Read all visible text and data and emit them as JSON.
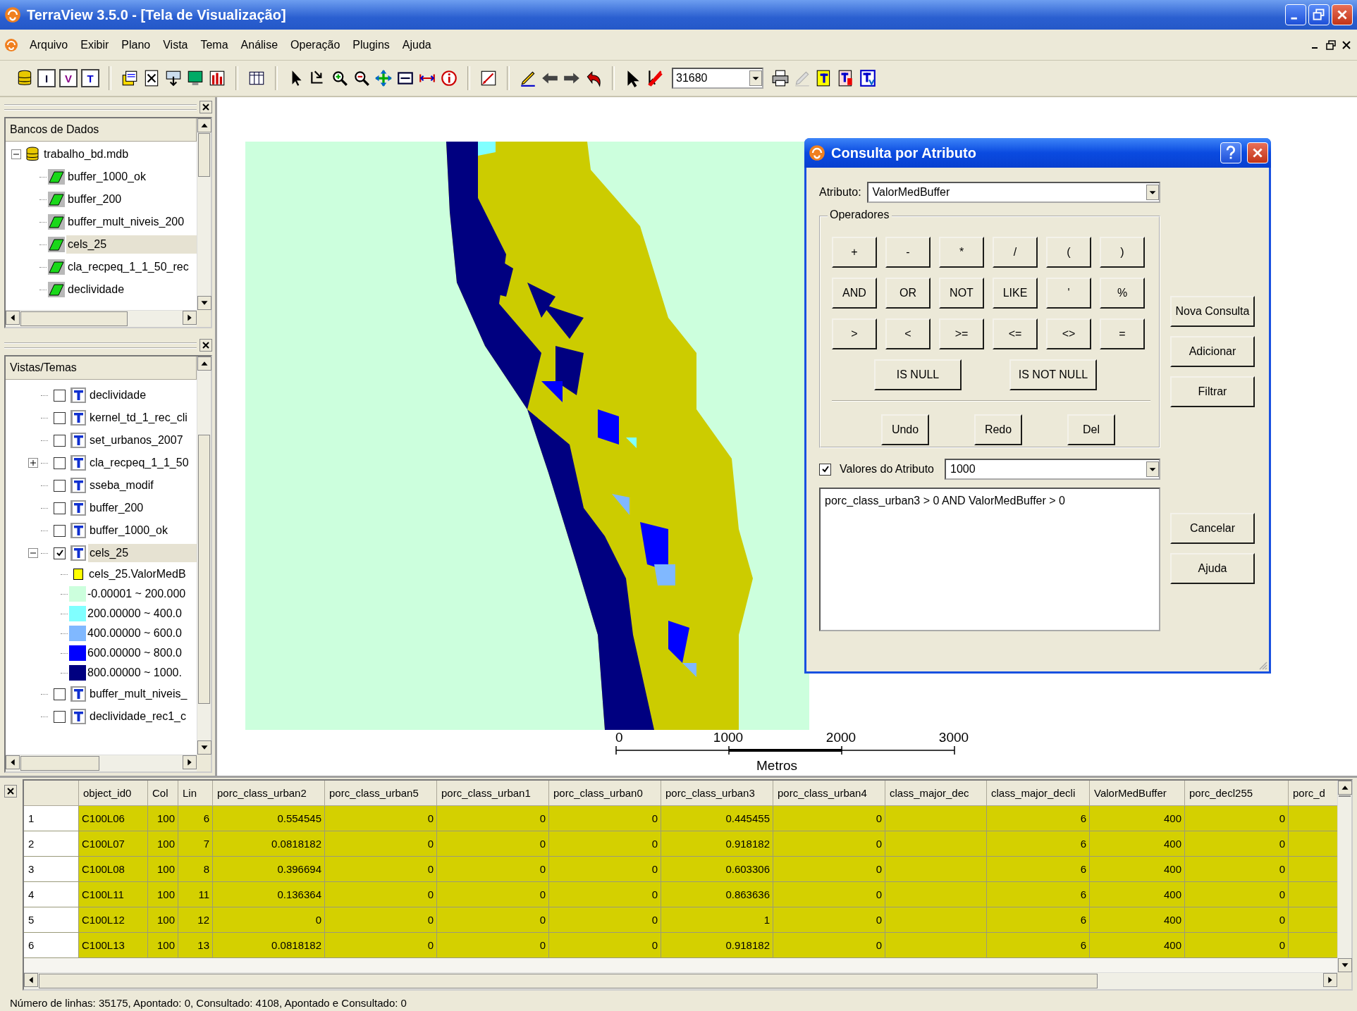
{
  "window": {
    "title": "TerraView 3.5.0 - [Tela de Visualização]"
  },
  "menu": [
    "Arquivo",
    "Exibir",
    "Plano",
    "Vista",
    "Tema",
    "Análise",
    "Operação",
    "Plugins",
    "Ajuda"
  ],
  "toolbar": [
    {
      "kind": "database"
    },
    {
      "kind": "letter",
      "text": "I"
    },
    {
      "kind": "letter",
      "text": "V"
    },
    {
      "kind": "letter",
      "text": "T"
    },
    {
      "kind": "sep"
    },
    {
      "kind": "layers"
    },
    {
      "kind": "document"
    },
    {
      "kind": "import"
    },
    {
      "kind": "monitor"
    },
    {
      "kind": "chart"
    },
    {
      "kind": "sep"
    },
    {
      "kind": "table"
    },
    {
      "kind": "sep"
    },
    {
      "kind": "pointer"
    },
    {
      "kind": "select"
    },
    {
      "kind": "zoom-in"
    },
    {
      "kind": "zoom-out"
    },
    {
      "kind": "pan"
    },
    {
      "kind": "frame"
    },
    {
      "kind": "measure"
    },
    {
      "kind": "info"
    },
    {
      "kind": "sep"
    },
    {
      "kind": "draw"
    },
    {
      "kind": "sep"
    },
    {
      "kind": "pencil"
    },
    {
      "kind": "arrow-left"
    },
    {
      "kind": "arrow-right"
    },
    {
      "kind": "undo"
    },
    {
      "kind": "sep"
    },
    {
      "kind": "cursor"
    },
    {
      "kind": "delete"
    },
    {
      "kind": "scale",
      "value": "31680"
    },
    {
      "kind": "printer"
    },
    {
      "kind": "edit-disabled"
    },
    {
      "kind": "doc-yellow"
    },
    {
      "kind": "doc-red"
    },
    {
      "kind": "doc-blue"
    }
  ],
  "databases_panel": {
    "title": "Bancos de Dados",
    "tree": [
      {
        "label": "trabalho_bd.mdb",
        "selected": false,
        "expanded": true,
        "children": [
          {
            "label": "buffer_1000_ok",
            "selected": false
          },
          {
            "label": "buffer_200",
            "selected": false
          },
          {
            "label": "buffer_mult_niveis_200",
            "selected": false
          },
          {
            "label": "cels_25",
            "selected": true
          },
          {
            "label": "cla_recpeq_1_1_50_rec",
            "selected": false
          },
          {
            "label": "declividade",
            "selected": false
          }
        ]
      }
    ]
  },
  "views_panel": {
    "title": "Vistas/Temas",
    "themes": [
      {
        "label": "declividade",
        "checked": false,
        "selected": false
      },
      {
        "label": "kernel_td_1_rec_cli",
        "checked": false,
        "selected": false
      },
      {
        "label": "set_urbanos_2007",
        "checked": false,
        "selected": false
      },
      {
        "label": "cla_recpeq_1_1_50",
        "checked": false,
        "selected": false,
        "expanded": false
      },
      {
        "label": "sseba_modif",
        "checked": false,
        "selected": false
      },
      {
        "label": "buffer_200",
        "checked": false,
        "selected": false
      },
      {
        "label": "buffer_1000_ok",
        "checked": false,
        "selected": false
      },
      {
        "label": "cels_25",
        "checked": true,
        "selected": true,
        "expanded": true,
        "children": [
          {
            "kind": "group",
            "label": "cels_25.ValorMedB",
            "color": "#ffff00"
          },
          {
            "kind": "class",
            "label": "-0.00001 ~ 200.000",
            "color": "#ccffdd"
          },
          {
            "kind": "class",
            "label": "200.00000 ~ 400.0",
            "color": "#80ffff"
          },
          {
            "kind": "class",
            "label": "400.00000 ~ 600.0",
            "color": "#80b8ff"
          },
          {
            "kind": "class",
            "label": "600.00000 ~ 800.0",
            "color": "#0000ff"
          },
          {
            "kind": "class",
            "label": "800.00000 ~ 1000.",
            "color": "#000080"
          }
        ]
      },
      {
        "label": "buffer_mult_niveis_",
        "checked": false,
        "selected": false
      },
      {
        "label": "declividade_rec1_c",
        "checked": false,
        "selected": false
      }
    ]
  },
  "map": {
    "scale_labels": [
      "0",
      "1000",
      "2000",
      "3000"
    ],
    "scale_unit": "Metros"
  },
  "dialog": {
    "title": "Consulta por Atributo",
    "attribute_label": "Atributo:",
    "attribute_value": "ValorMedBuffer",
    "operators_label": "Operadores",
    "operators": [
      [
        "+",
        "-",
        "*",
        "/",
        "(",
        ")"
      ],
      [
        "AND",
        "OR",
        "NOT",
        "LIKE",
        "'",
        "%"
      ],
      [
        ">",
        "<",
        ">=",
        "<=",
        "<>",
        "="
      ]
    ],
    "null_buttons": [
      "IS NULL",
      "IS NOT NULL"
    ],
    "edit_buttons": [
      "Undo",
      "Redo",
      "Del"
    ],
    "side_buttons": [
      "Nova Consulta",
      "Adicionar",
      "Filtrar"
    ],
    "bottom_buttons": [
      "Cancelar",
      "Ajuda"
    ],
    "values_checkbox": {
      "label": "Valores do Atributo",
      "checked": true
    },
    "values_value": "1000",
    "query": "porc_class_urban3 > 0 AND ValorMedBuffer > 0"
  },
  "table": {
    "columns": [
      "object_id0",
      "Col",
      "Lin",
      "porc_class_urban2",
      "porc_class_urban5",
      "porc_class_urban1",
      "porc_class_urban0",
      "porc_class_urban3",
      "porc_class_urban4",
      "class_major_dec",
      "class_major_decli",
      "ValorMedBuffer",
      "porc_decl255",
      "porc_d"
    ],
    "rows": [
      {
        "number": "1",
        "queried": true,
        "cells": [
          "C100L06",
          "100",
          "6",
          "0.554545",
          "0",
          "0",
          "0",
          "0.445455",
          "0",
          null,
          "6",
          "400",
          "0",
          null
        ]
      },
      {
        "number": "2",
        "queried": true,
        "cells": [
          "C100L07",
          "100",
          "7",
          "0.0818182",
          "0",
          "0",
          "0",
          "0.918182",
          "0",
          null,
          "6",
          "400",
          "0",
          null
        ]
      },
      {
        "number": "3",
        "queried": true,
        "cells": [
          "C100L08",
          "100",
          "8",
          "0.396694",
          "0",
          "0",
          "0",
          "0.603306",
          "0",
          null,
          "6",
          "400",
          "0",
          null
        ]
      },
      {
        "number": "4",
        "queried": true,
        "cells": [
          "C100L11",
          "100",
          "11",
          "0.136364",
          "0",
          "0",
          "0",
          "0.863636",
          "0",
          null,
          "6",
          "400",
          "0",
          null
        ]
      },
      {
        "number": "5",
        "queried": true,
        "cells": [
          "C100L12",
          "100",
          "12",
          "0",
          "0",
          "0",
          "0",
          "1",
          "0",
          null,
          "6",
          "400",
          "0",
          null
        ]
      },
      {
        "number": "6",
        "queried": true,
        "cells": [
          "C100L13",
          "100",
          "13",
          "0.0818182",
          "0",
          "0",
          "0",
          "0.918182",
          "0",
          null,
          "6",
          "400",
          "0",
          null
        ]
      }
    ]
  },
  "status_bar": "Número de linhas: 35175, Apontado: 0, Consultado: 4108, Apontado e Consultado: 0"
}
